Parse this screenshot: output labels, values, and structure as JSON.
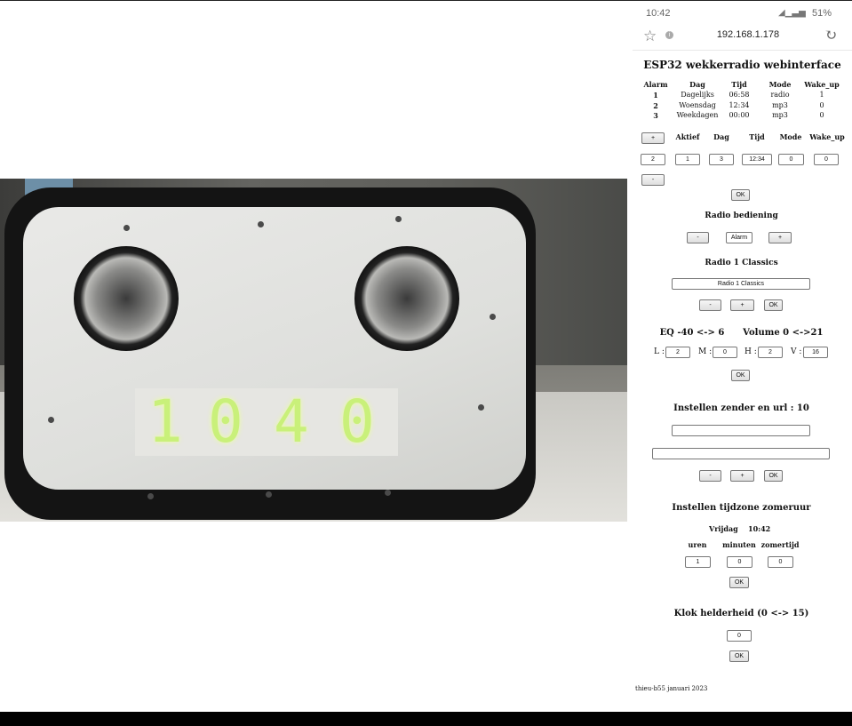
{
  "status_bar": {
    "time": "10:42",
    "battery": "51%"
  },
  "browser": {
    "url": "192.168.1.178"
  },
  "page": {
    "title": "ESP32 wekkerradio webinterface",
    "alarm_table": {
      "headers": [
        "Alarm",
        "Dag",
        "Tijd",
        "Mode",
        "Wake_up"
      ],
      "rows": [
        [
          "1",
          "Dagelijks",
          "06:58",
          "radio",
          "1"
        ],
        [
          "2",
          "Woensdag",
          "12:34",
          "mp3",
          "0"
        ],
        [
          "3",
          "Weekdagen",
          "00:00",
          "mp3",
          "0"
        ]
      ]
    },
    "edit_alarm": {
      "plus": "+",
      "minus": "-",
      "headers": [
        "Aktief",
        "Dag",
        "Tijd",
        "Mode",
        "Wake_up"
      ],
      "alarm_value": "2",
      "values": [
        "1",
        "3",
        "12:34",
        "0",
        "0"
      ],
      "ok": "OK"
    },
    "radio": {
      "title": "Radio bediening",
      "minus": "-",
      "mode_value": "Alarm",
      "plus": "+",
      "station_title": "Radio 1 Classics",
      "station_value": "Radio 1 Classics",
      "btn_minus": "-",
      "btn_plus": "+",
      "ok": "OK"
    },
    "eq": {
      "title": "EQ -40 <-> 6      Volume 0 <->21",
      "labels": {
        "l": "L :",
        "m": "M :",
        "h": "H :",
        "v": "V :"
      },
      "values": {
        "l": "2",
        "m": "0",
        "h": "2",
        "v": "16"
      },
      "ok": "OK"
    },
    "station_url": {
      "title": "Instellen zender en url : 10",
      "name_value": "",
      "url_value": "",
      "btn_minus": "-",
      "btn_plus": "+",
      "ok": "OK"
    },
    "timezone": {
      "title": "Instellen tijdzone zomeruur",
      "day": "Vrijdag",
      "time": "10:42",
      "headers": [
        "uren",
        "minuten",
        "zomertijd"
      ],
      "values": [
        "1",
        "0",
        "0"
      ],
      "ok": "OK"
    },
    "brightness": {
      "title": "Klok helderheid (0 <-> 15)",
      "value": "0",
      "ok": "OK"
    },
    "footer": "thieu-b55 januari 2023"
  },
  "photo": {
    "display_digits": [
      "1",
      "0",
      "4",
      "0"
    ]
  }
}
